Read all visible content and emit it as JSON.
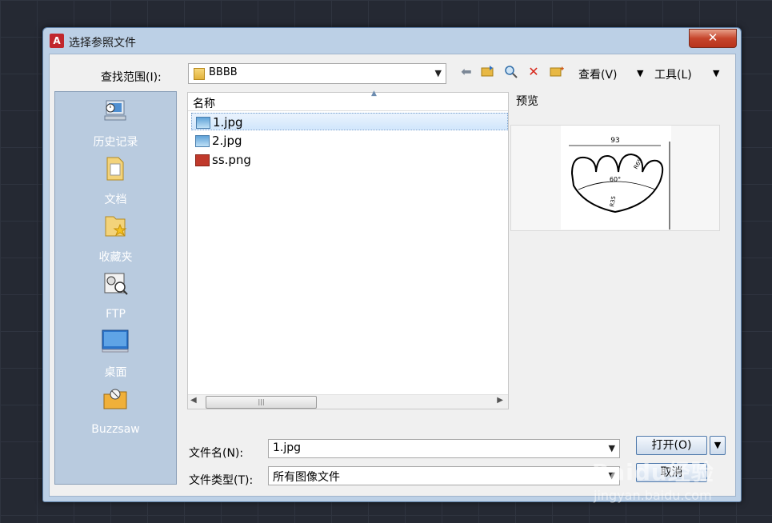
{
  "window": {
    "title": "选择参照文件",
    "close_glyph": "✕"
  },
  "lookin": {
    "label": "查找范围(I):",
    "value": "BBBB"
  },
  "toolbar": {
    "view_label": "查看(V)",
    "tools_label": "工具(L)"
  },
  "places": [
    {
      "label": "历史记录",
      "icon": "history-icon"
    },
    {
      "label": "文档",
      "icon": "documents-folder-icon"
    },
    {
      "label": "收藏夹",
      "icon": "favorites-folder-icon"
    },
    {
      "label": "FTP",
      "icon": "ftp-icon"
    },
    {
      "label": "桌面",
      "icon": "desktop-icon"
    },
    {
      "label": "Buzzsaw",
      "icon": "buzzsaw-icon"
    }
  ],
  "filelist": {
    "column_name": "名称",
    "files": [
      {
        "name": "1.jpg",
        "type": "jpg",
        "selected": true
      },
      {
        "name": "2.jpg",
        "type": "jpg",
        "selected": false
      },
      {
        "name": "ss.png",
        "type": "png",
        "selected": false
      }
    ]
  },
  "preview": {
    "label": "预览",
    "drawing_texts": {
      "width": "93",
      "radius_small": "R65",
      "angle": "60°",
      "radius_large": "R35"
    }
  },
  "filename": {
    "label": "文件名(N):",
    "value": "1.jpg"
  },
  "filetype": {
    "label": "文件类型(T):",
    "value": "所有图像文件"
  },
  "buttons": {
    "open": "打开(O)",
    "cancel": "取消"
  },
  "watermark": {
    "line1": "Baidu经验",
    "line2": "jingyan.baidu.com"
  }
}
